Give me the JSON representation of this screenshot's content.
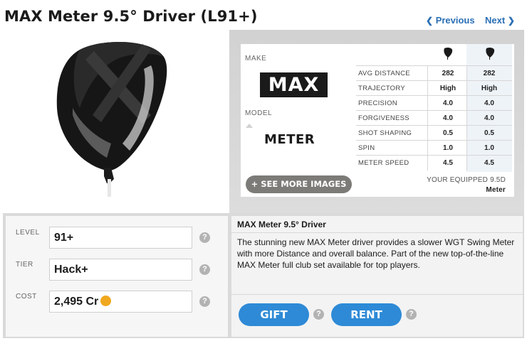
{
  "header": {
    "title": "MAX Meter 9.5° Driver (L91+)",
    "prev_label": "Previous",
    "next_label": "Next",
    "link_color": "#2b6fb5"
  },
  "specs": {
    "make_label": "MAKE",
    "make_logo": "MAX",
    "model_label": "MODEL",
    "model_logo": "METER",
    "column_icons": [
      "driver-head-icon",
      "driver-head-icon"
    ],
    "rows": [
      {
        "key": "AVG DISTANCE",
        "v1": "282",
        "v2": "282"
      },
      {
        "key": "TRAJECTORY",
        "v1": "High",
        "v2": "High"
      },
      {
        "key": "PRECISION",
        "v1": "4.0",
        "v2": "4.0"
      },
      {
        "key": "FORGIVENESS",
        "v1": "4.0",
        "v2": "4.0"
      },
      {
        "key": "SHOT SHAPING",
        "v1": "0.5",
        "v2": "0.5"
      },
      {
        "key": "SPIN",
        "v1": "1.0",
        "v2": "1.0"
      },
      {
        "key": "METER SPEED",
        "v1": "4.5",
        "v2": "4.5"
      }
    ],
    "see_more_label": "+ SEE MORE IMAGES",
    "equipped_label": "YOUR EQUIPPED 9.5D",
    "equipped_model": "Meter"
  },
  "details": {
    "level_label": "LEVEL",
    "level_value": "91+",
    "tier_label": "TIER",
    "tier_value": "Hack+",
    "cost_label": "COST",
    "cost_value": "2,495 Cr",
    "help_glyph": "?"
  },
  "description": {
    "title": "MAX Meter 9.5° Driver",
    "text": "The stunning new MAX Meter driver provides a slower WGT Swing Meter with more Distance and overall balance. Part of the new top-of-the-line MAX Meter full club set available for top players."
  },
  "actions": {
    "gift_label": "GIFT",
    "rent_label": "RENT",
    "button_color": "#2e8ad6"
  }
}
